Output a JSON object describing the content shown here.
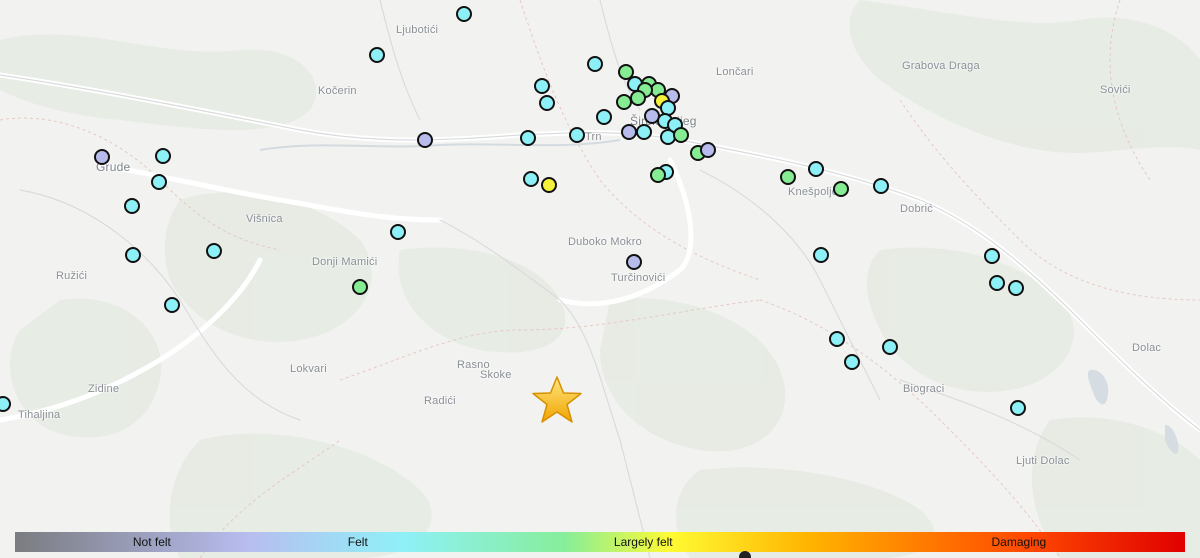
{
  "map": {
    "places": [
      {
        "name": "Ljubotići",
        "key": "ljubotici"
      },
      {
        "name": "Kočerin",
        "key": "kocerin"
      },
      {
        "name": "Grude",
        "key": "grude"
      },
      {
        "name": "Višnica",
        "key": "visnica"
      },
      {
        "name": "Ružići",
        "key": "ruzici"
      },
      {
        "name": "Donji Mamići",
        "key": "donji-mamici"
      },
      {
        "name": "Lokvari",
        "key": "lokvari"
      },
      {
        "name": "Zidine",
        "key": "zidine"
      },
      {
        "name": "Tihaljina",
        "key": "tihaljina"
      },
      {
        "name": "Rasno",
        "key": "rasno"
      },
      {
        "name": "Skoke",
        "key": "skoke"
      },
      {
        "name": "Radići",
        "key": "radici"
      },
      {
        "name": "Duboko Mokro",
        "key": "duboko-mokro"
      },
      {
        "name": "Turčinovići",
        "key": "turcinovici"
      },
      {
        "name": "Trn",
        "key": "trn"
      },
      {
        "name": "Lončari",
        "key": "loncari"
      },
      {
        "name": "Grabova Draga",
        "key": "grabova-draga"
      },
      {
        "name": "Sovići",
        "key": "sovici"
      },
      {
        "name": "Knešpolje",
        "key": "knespolje"
      },
      {
        "name": "Dobrić",
        "key": "dobric"
      },
      {
        "name": "Dolac",
        "key": "dolac"
      },
      {
        "name": "Biograci",
        "key": "biograci"
      },
      {
        "name": "Ljuti Dolac",
        "key": "ljuti-dolac"
      },
      {
        "name": "Široki Brijeg",
        "key": "siroki-brijeg"
      }
    ],
    "epicenter_icon": "star-icon",
    "report_colors": {
      "not_felt": "#b7bcec",
      "felt": "#8ef0f7",
      "largely_felt": "#86ec94",
      "strong": "#f4f13a",
      "outline": "#111111"
    }
  },
  "legend": {
    "labels": [
      "Not felt",
      "Felt",
      "Largely felt",
      "Damaging"
    ],
    "colors": [
      "#7a7c80",
      "#b8bdf0",
      "#8ff0f8",
      "#86ee9a",
      "#fffb33",
      "#ffb300",
      "#ff4b00",
      "#e00000"
    ]
  }
}
